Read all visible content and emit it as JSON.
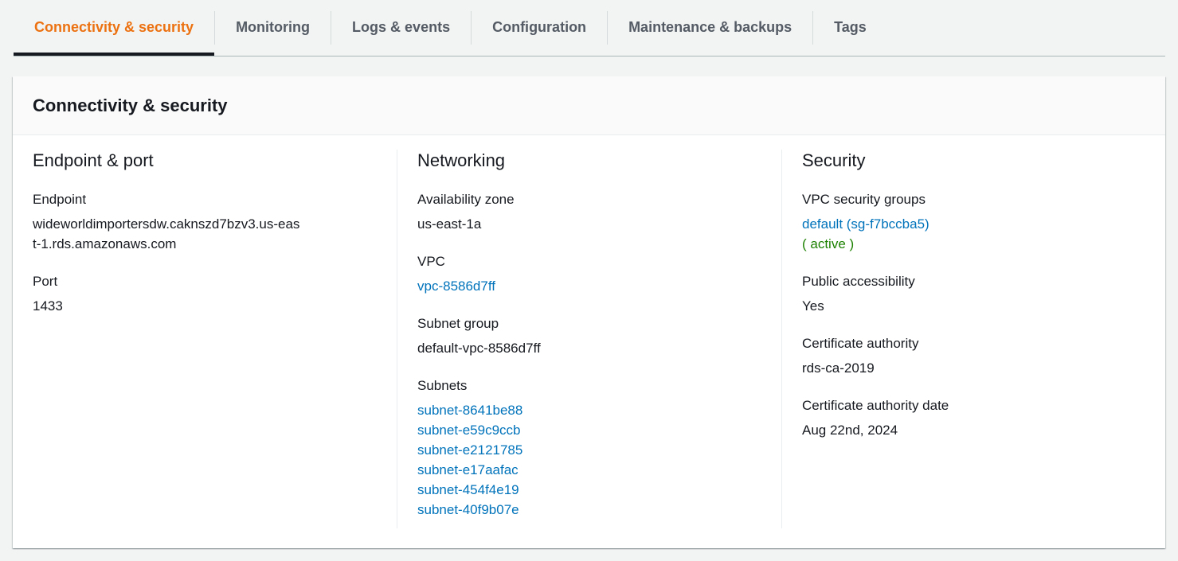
{
  "tabs": [
    {
      "label": "Connectivity & security",
      "active": true
    },
    {
      "label": "Monitoring",
      "active": false
    },
    {
      "label": "Logs & events",
      "active": false
    },
    {
      "label": "Configuration",
      "active": false
    },
    {
      "label": "Maintenance & backups",
      "active": false
    },
    {
      "label": "Tags",
      "active": false
    }
  ],
  "panel": {
    "title": "Connectivity & security"
  },
  "endpoint_port": {
    "heading": "Endpoint & port",
    "endpoint_label": "Endpoint",
    "endpoint_value": "wideworldimportersdw.caknszd7bzv3.us-east-1.rds.amazonaws.com",
    "port_label": "Port",
    "port_value": "1433"
  },
  "networking": {
    "heading": "Networking",
    "az_label": "Availability zone",
    "az_value": "us-east-1a",
    "vpc_label": "VPC",
    "vpc_value": "vpc-8586d7ff",
    "subnet_group_label": "Subnet group",
    "subnet_group_value": "default-vpc-8586d7ff",
    "subnets_label": "Subnets",
    "subnets": [
      "subnet-8641be88",
      "subnet-e59c9ccb",
      "subnet-e2121785",
      "subnet-e17aafac",
      "subnet-454f4e19",
      "subnet-40f9b07e"
    ]
  },
  "security": {
    "heading": "Security",
    "sg_label": "VPC security groups",
    "sg_value": "default (sg-f7bccba5)",
    "sg_status": "( active )",
    "public_label": "Public accessibility",
    "public_value": "Yes",
    "ca_label": "Certificate authority",
    "ca_value": "rds-ca-2019",
    "ca_date_label": "Certificate authority date",
    "ca_date_value": "Aug 22nd, 2024"
  },
  "colors": {
    "accent": "#ec7211",
    "link": "#0073bb",
    "success": "#1d8102",
    "text": "#16191f",
    "tab_inactive": "#545b64"
  }
}
